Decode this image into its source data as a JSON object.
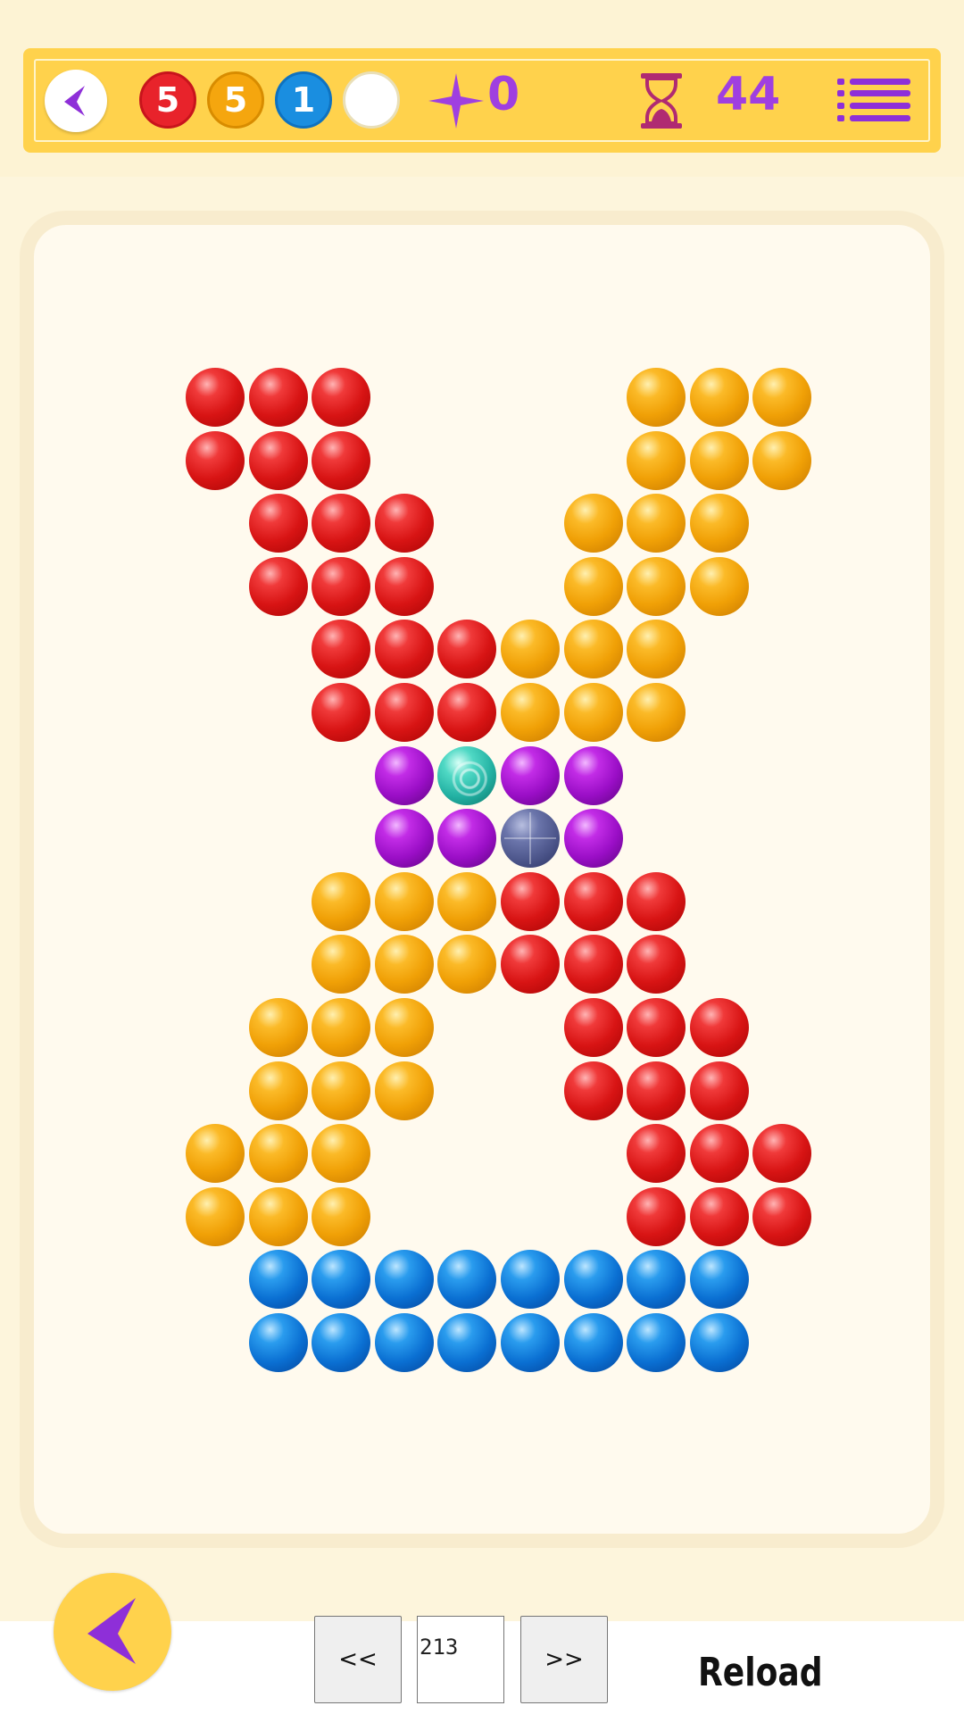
{
  "header": {
    "counters": [
      {
        "value": "5",
        "color": "red"
      },
      {
        "value": "5",
        "color": "orange"
      },
      {
        "value": "1",
        "color": "blue"
      },
      {
        "value": "",
        "color": "white"
      }
    ],
    "stars": "0",
    "time_left": "44"
  },
  "board": {
    "columns": 10,
    "rows": 16,
    "grid": [
      "RRR....OOO",
      "RRR....OOO",
      ".RRR..OOO.",
      ".RRR..OOO.",
      "..RRROOO..",
      "..RRROOO..",
      "...PTPP...",
      "...PPSP...",
      "..OOORRR..",
      "..OOORRR..",
      ".OOO..RRR.",
      ".OOO..RRR.",
      "OOO....RRR",
      "OOO....RRR",
      ".BBBBBBBB.",
      ".BBBBBBBB."
    ],
    "legend": {
      "R": "red-ball",
      "O": "orange-ball",
      "B": "blue-ball",
      "P": "purple-ball",
      "T": "teal-swirl-ball",
      "S": "slate-ball"
    }
  },
  "footer": {
    "prev_label": "<<",
    "level": "213",
    "next_label": ">>",
    "reload_label": "Reload"
  },
  "colors": {
    "background": "#fdf5dc",
    "header_bar": "#ffd24c",
    "accent_purple": "#9f3fe0",
    "board_border": "#f8ecce"
  }
}
